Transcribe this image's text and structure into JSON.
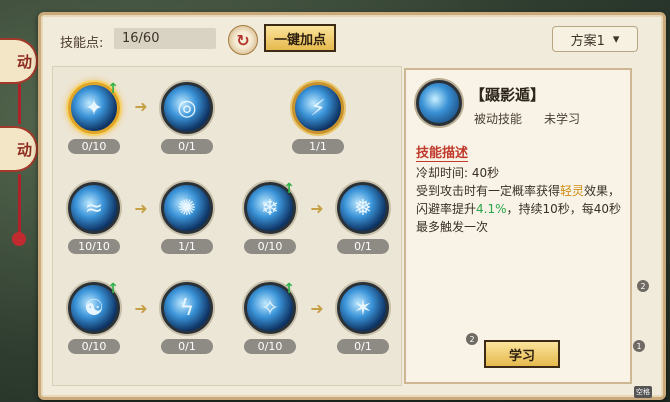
{
  "side_tabs": [
    "动",
    "动"
  ],
  "header": {
    "points_label": "技能点:",
    "points_value": "16/60",
    "quick_add_label": "一键加点",
    "plan_label": "方案1",
    "plan_caret": "▾"
  },
  "skills": [
    {
      "level": "0/10",
      "upgradable": true
    },
    {
      "level": "0/1",
      "upgradable": false
    },
    {
      "level": "1/1",
      "upgradable": false
    },
    {
      "level": "10/10",
      "upgradable": false
    },
    {
      "level": "1/1",
      "upgradable": false
    },
    {
      "level": "0/10",
      "upgradable": true
    },
    {
      "level": "0/1",
      "upgradable": false
    },
    {
      "level": "0/10",
      "upgradable": true
    },
    {
      "level": "0/1",
      "upgradable": false
    },
    {
      "level": "0/10",
      "upgradable": true
    },
    {
      "level": "0/1",
      "upgradable": false
    }
  ],
  "detail": {
    "name": "【蹑影遁】",
    "type": "被动技能",
    "status": "未学习",
    "section_title": "技能描述",
    "cooldown": "冷却时间: 40秒",
    "desc_part1": "受到攻击时有一定概率获得",
    "desc_hl1": "轻灵",
    "desc_part2": "效果，闪避率提升",
    "desc_hl2": "4.1%",
    "desc_part3": "，持续10秒，每40秒最多触发一次",
    "learn_label": "学习"
  },
  "corner_markers": [
    "2",
    "2",
    "1"
  ],
  "corner_tag": "空格"
}
